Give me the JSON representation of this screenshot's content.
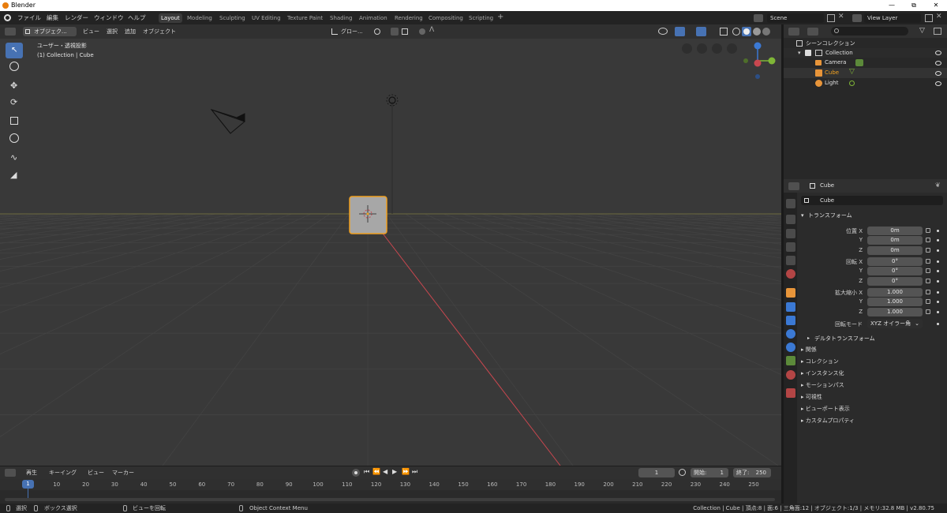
{
  "window": {
    "title": "Blender",
    "min_icon": "minimize-icon",
    "max_icon": "maximize-icon",
    "close_icon": "close-icon"
  },
  "menu": {
    "items": [
      "ファイル",
      "編集",
      "レンダー",
      "ウィンドウ",
      "ヘルプ"
    ]
  },
  "workspaces": [
    "Layout",
    "Modeling",
    "Sculpting",
    "UV Editing",
    "Texture Paint",
    "Shading",
    "Animation",
    "Rendering",
    "Compositing",
    "Scripting"
  ],
  "scene": {
    "name": "Scene",
    "view_layer": "View Layer"
  },
  "viewport_header": {
    "mode": "オブジェク...",
    "view": "ビュー",
    "select": "選択",
    "add": "追加",
    "object": "オブジェクト",
    "orientation": "グロー..."
  },
  "viewport": {
    "view_name": "ユーザー・透視投影",
    "collection_info": "(1) Collection | Cube"
  },
  "outliner": {
    "root": "シーンコレクション",
    "collection": "Collection",
    "items": [
      {
        "name": "Camera",
        "icon": "camera-icon"
      },
      {
        "name": "Cube",
        "icon": "mesh-icon"
      },
      {
        "name": "Light",
        "icon": "light-icon"
      }
    ]
  },
  "properties": {
    "header_object": "Cube",
    "object_name": "Cube",
    "transform_title": "トランスフォーム",
    "location_label": "位置 X",
    "rotation_label": "回転 X",
    "scale_label": "拡大縮小 X",
    "y_label": "Y",
    "z_label": "Z",
    "location": [
      "0m",
      "0m",
      "0m"
    ],
    "rotation": [
      "0°",
      "0°",
      "0°"
    ],
    "scale": [
      "1.000",
      "1.000",
      "1.000"
    ],
    "rotation_mode_label": "回転モード",
    "rotation_mode": "XYZ オイラー角",
    "delta_transform": "デルタトランスフォーム",
    "panels": [
      "関係",
      "コレクション",
      "インスタンス化",
      "モーションパス",
      "可視性",
      "ビューポート表示",
      "カスタムプロパティ"
    ]
  },
  "timeline": {
    "playback": "再生",
    "keying": "キーイング",
    "view": "ビュー",
    "marker": "マーカー",
    "current_frame": "1",
    "start_label": "開始:",
    "start": "1",
    "end_label": "終了:",
    "end": "250",
    "ticks": [
      "10",
      "20",
      "30",
      "40",
      "50",
      "60",
      "70",
      "80",
      "90",
      "100",
      "110",
      "120",
      "130",
      "140",
      "150",
      "160",
      "170",
      "180",
      "190",
      "200",
      "210",
      "220",
      "230",
      "240",
      "250"
    ],
    "current_marker": "1"
  },
  "status": {
    "select": "選択",
    "box_select": "ボックス選択",
    "rotate_view": "ビューを回転",
    "context_menu": "Object Context Menu",
    "stats": "Collection | Cube | 頂点:8 | 面:6 | 三角面:12 | オブジェクト:1/3 | メモリ:32.8 MB | v2.80.75"
  },
  "colors": {
    "accent": "#4772b3",
    "selected_orange": "#f0a020",
    "x_axis": "#c8474f",
    "y_axis": "#7fb637",
    "z_axis": "#3b79d4"
  }
}
